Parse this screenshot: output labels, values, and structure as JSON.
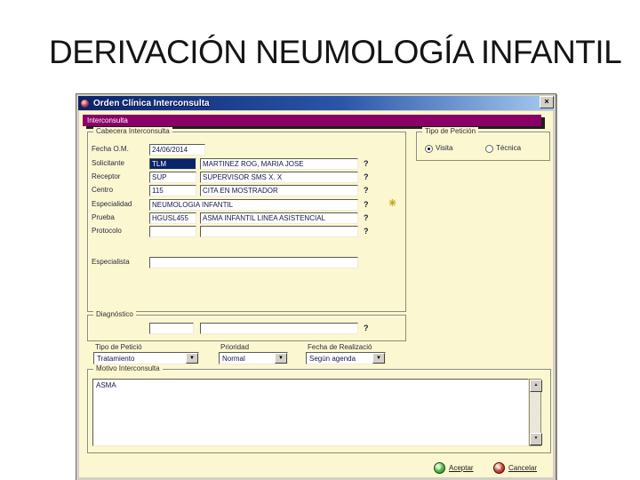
{
  "slide": {
    "title": "DERIVACIÓN NEUMOLOGÍA INFANTIL"
  },
  "window": {
    "title": "Orden Clínica Interconsulta",
    "close_glyph": "×",
    "menu_label": "Interconsulta",
    "groups": {
      "cabecera": {
        "caption": "Cabecera Interconsulta"
      },
      "tipo_peticion": {
        "caption": "Tipo de Petición",
        "options": [
          {
            "label": "Visita",
            "selected": true
          },
          {
            "label": "Técnica",
            "selected": false
          }
        ]
      },
      "diagnostico": {
        "caption": "Diagnóstico",
        "help": "?"
      },
      "motivo": {
        "caption": "Motivo Interconsulta",
        "text": "ASMA"
      }
    },
    "fields": {
      "fecha": {
        "label": "Fecha O.M.",
        "value": "24/06/2014"
      },
      "solicitante": {
        "label": "Solicitante",
        "code": "TLM",
        "value": "MARTINEZ ROG, MARIA JOSE",
        "help": "?"
      },
      "receptor": {
        "label": "Receptor",
        "code": "SUP",
        "value": "SUPERVISOR SMS X. X",
        "help": "?"
      },
      "centro": {
        "label": "Centro",
        "code": "115",
        "value": "CITA EN MOSTRADOR",
        "help": "?"
      },
      "especialidad": {
        "label": "Especialidad",
        "value": "NEUMOLOGIA INFANTIL",
        "help": "?"
      },
      "prueba": {
        "label": "Prueba",
        "code": "HGUSL455",
        "value": "ASMA INFANTIL LINEA ASISTENCIAL",
        "help": "?"
      },
      "protocolo": {
        "label": "Protocolo",
        "code": "",
        "value": "",
        "help": "?"
      },
      "especialista": {
        "label": "Especialista",
        "value": ""
      }
    },
    "selects": {
      "tipo": {
        "label": "Tipo de Petició",
        "value": "Tratamiento"
      },
      "prioridad": {
        "label": "Prioridad",
        "value": "Normal"
      },
      "fecha_realizacion": {
        "label": "Fecha de Realizació",
        "value": "Según agenda"
      }
    },
    "icons": {
      "sparkle": "✳",
      "scroll_up": "▲",
      "scroll_down": "▼",
      "combo_arrow": "▼",
      "accept_glyph": "✓",
      "cancel_glyph": "✕"
    },
    "buttons": {
      "aceptar": "Aceptar",
      "cancelar": "Cancelar"
    },
    "colors": {
      "banner_purple": "#8a0069",
      "titlebar_blue": "#0a246a",
      "client_cream": "#fbf7d1",
      "selection_blue": "#0a246a",
      "accept_green": "#1e7a18",
      "cancel_red": "#8a1410"
    }
  }
}
